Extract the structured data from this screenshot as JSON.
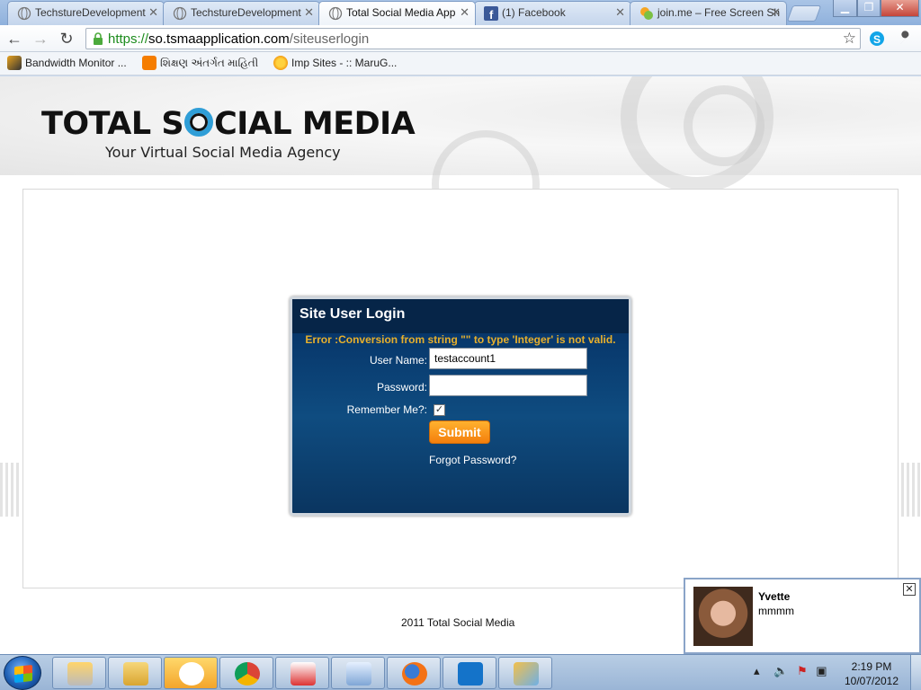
{
  "tabs": [
    {
      "label": "TechstureDevelopment",
      "icon": "globe-icon"
    },
    {
      "label": "TechstureDevelopment",
      "icon": "globe-icon"
    },
    {
      "label": "Total Social Media App",
      "icon": "globe-icon"
    },
    {
      "label": "(1) Facebook",
      "icon": "facebook-icon"
    },
    {
      "label": "join.me – Free Screen Sh",
      "icon": "joinme-icon"
    }
  ],
  "toolbar": {
    "url_scheme": "https://",
    "url_host": "so.tsmaapplication.com",
    "url_path": "/siteuserlogin"
  },
  "bookmarks": [
    {
      "label": "Bandwidth Monitor ...",
      "icon": "tiger-icon"
    },
    {
      "label": "શિક્ષણ અંતર્ગત માહિતી",
      "icon": "blogger-icon"
    },
    {
      "label": "Imp Sites - :: MaruG...",
      "icon": "sun-icon"
    }
  ],
  "site": {
    "logo_left": "TOTAL S",
    "logo_right": "CIAL MEDIA",
    "tagline": "Your Virtual Social Media Agency",
    "footer": "2011 Total Social Media"
  },
  "login": {
    "title": "Site User Login",
    "error": "Error :Conversion from string \"\" to type 'Integer' is not valid.",
    "username_label": "User Name:",
    "username_value": "testaccount1",
    "password_label": "Password:",
    "password_value": "",
    "remember_label": "Remember Me?:",
    "remember_checked": true,
    "submit_label": "Submit",
    "forgot_label": "Forgot Password?"
  },
  "chat": {
    "name": "Yvette",
    "message": "mmmm"
  },
  "taskbar": {
    "apps": [
      "wrench-app-icon",
      "explorer-icon",
      "gtalk-icon",
      "chrome-icon",
      "reminder-icon",
      "notepad-icon",
      "firefox-icon",
      "teamviewer-icon",
      "paint-icon"
    ],
    "time": "2:19 PM",
    "date": "10/07/2012"
  }
}
